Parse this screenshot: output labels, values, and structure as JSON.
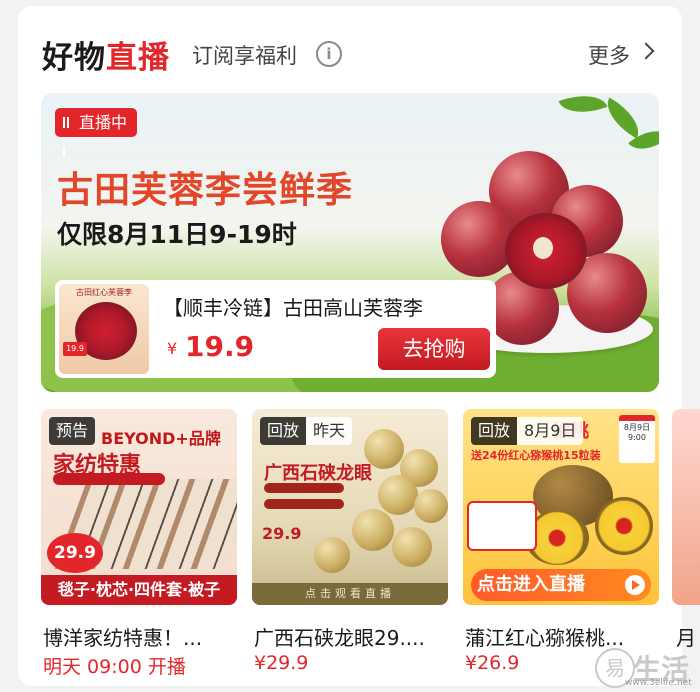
{
  "header": {
    "title_prefix": "好物",
    "title_live": "直播",
    "subtitle": "订阅享福利",
    "more_label": "更多"
  },
  "banner": {
    "live_badge": "直播中",
    "title": "古田芙蓉李尝鲜季",
    "date_text": "仅限8月11日9-19时",
    "product": {
      "name": "【顺丰冷链】古田高山芙蓉李",
      "currency": "¥",
      "price": "19.9",
      "buy_label": "去抢购",
      "thumb_label": "古田红心芙蓉李",
      "thumb_price": "19.9"
    }
  },
  "live_items": [
    {
      "badge": "预告",
      "badge_extra": "",
      "brand": "BEYOND",
      "brand_suffix": "品牌",
      "heading": "家纺特惠",
      "price_badge": "29.9",
      "strip": "毯子·枕芯·四件套·被子",
      "name": "博洋家纺特惠！...",
      "status": "明天 09:00 开播",
      "status_color": "#e3262a"
    },
    {
      "badge": "回放",
      "badge_extra": "昨天",
      "heading": "广西石硖龙眼",
      "price_badge": "29.9",
      "strip": "点击观看直播",
      "name": "广西石硖龙眼29....",
      "status": "¥29.9",
      "status_color": "#e3262a"
    },
    {
      "badge": "回放",
      "badge_extra": "8月9日",
      "heading": "猴桃",
      "sub": "送24份红心猕猴桃15粒装",
      "cta": "点击进入直播",
      "calendar": "8月9日 9:00",
      "name": "蒲江红心猕猴桃...",
      "status": "¥26.9",
      "status_color": "#e3262a"
    }
  ],
  "partial_item": {
    "name_glyph": "月"
  },
  "watermark": {
    "text": "生活",
    "url": "www.3elife.net"
  },
  "colors": {
    "accent": "#e3262a",
    "background": "#f2f2f2",
    "card": "#ffffff"
  }
}
